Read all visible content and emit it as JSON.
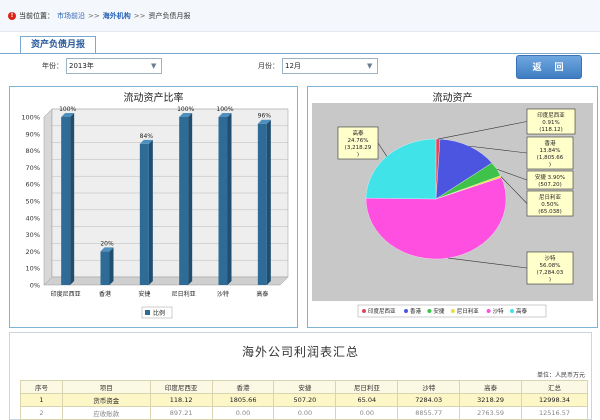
{
  "breadcrumb": {
    "prefix": "当前位置：",
    "items": [
      "市场前沿",
      "海外机构",
      "资产负债月报"
    ],
    "separator": ">>"
  },
  "panel_tab": "资产负债月报",
  "filters": {
    "year_label": "年份：",
    "year_value": "2013年",
    "month_label": "月份：",
    "month_value": "12月"
  },
  "back_button": "返　回",
  "chart_data": [
    {
      "type": "bar",
      "title": "流动资产比率",
      "categories": [
        "印度尼西亚",
        "香港",
        "安捷",
        "尼日利亚",
        "沙特",
        "高泰"
      ],
      "values": [
        100,
        20,
        84,
        100,
        100,
        96
      ],
      "data_labels": [
        "100%",
        "20%",
        "84%",
        "100%",
        "100%",
        "96%"
      ],
      "ylim": [
        0,
        100
      ],
      "y_ticks": [
        "0%",
        "10%",
        "20%",
        "30%",
        "40%",
        "50%",
        "60%",
        "70%",
        "80%",
        "90%",
        "100%"
      ],
      "legend": [
        {
          "label": "比例",
          "color": "#2e6c97"
        }
      ],
      "legend_position": "bottom",
      "grid": true
    },
    {
      "type": "pie",
      "title": "流动资产",
      "slices": [
        {
          "label": "印度尼西亚",
          "percent": 0.91,
          "color": "#e0475a"
        },
        {
          "label": "香港",
          "percent": 13.84,
          "color": "#4b55e0"
        },
        {
          "label": "安捷",
          "percent": 3.9,
          "color": "#3fc24a"
        },
        {
          "label": "尼日利亚",
          "percent": 0.5,
          "color": "#e8e03a"
        },
        {
          "label": "沙特",
          "percent": 56.08,
          "color": "#ff4fe0"
        },
        {
          "label": "高泰",
          "percent": 24.76,
          "color": "#3fe3e8"
        }
      ],
      "callouts": [
        {
          "lines": [
            "印度尼西亚",
            "0.91%",
            "(118.12)"
          ]
        },
        {
          "lines": [
            "香港",
            "13.84%",
            "(1,805.66",
            ")"
          ]
        },
        {
          "lines": [
            "安捷 3.90%",
            "(507.20)"
          ]
        },
        {
          "lines": [
            "尼日利亚",
            "0.50%",
            "(65.038)"
          ]
        },
        {
          "lines": [
            "沙特",
            "56.08%",
            "(7,284.03",
            ")"
          ]
        },
        {
          "lines": [
            "高泰",
            "24.76%",
            "(3,218.29",
            ")"
          ]
        }
      ],
      "legend_position": "bottom"
    }
  ],
  "summary": {
    "title": "海外公司利润表汇总",
    "unit": "单位：人民币万元",
    "columns": [
      "序号",
      "项目",
      "印度尼西亚",
      "香港",
      "安捷",
      "尼日利亚",
      "沙特",
      "高泰",
      "汇总"
    ],
    "rows": [
      [
        "1",
        "货币资金",
        "118.12",
        "1805.66",
        "507.20",
        "65.04",
        "7284.03",
        "3218.29",
        "12998.34"
      ],
      [
        "2",
        "应收账款",
        "897.21",
        "0.00",
        "0.00",
        "0.00",
        "8855.77",
        "2763.59",
        "12516.57"
      ]
    ]
  },
  "colors": {
    "bar": "#2e6c97",
    "plot_bg": "#c8c8c8",
    "panel_border": "#7fb3d6",
    "accent_blue": "#4a86c8"
  }
}
